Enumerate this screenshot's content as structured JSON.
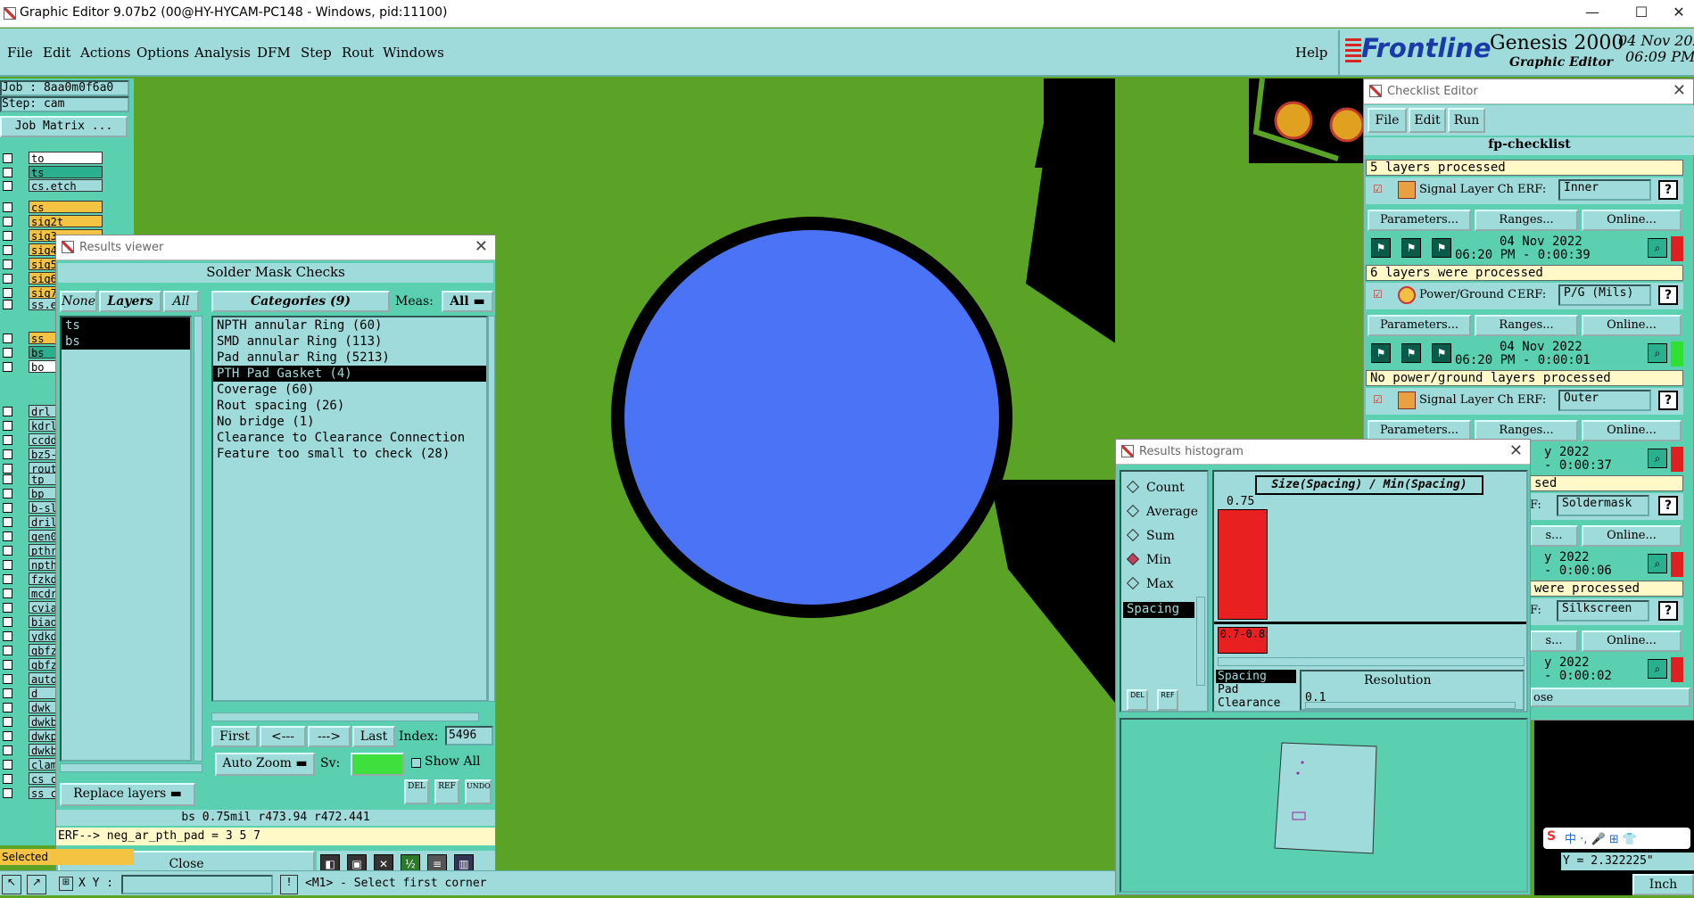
{
  "window": {
    "title": "Graphic Editor 9.07b2 (00@HY-HYCAM-PC148 - Windows, pid:11100)"
  },
  "menu": {
    "items": [
      "File",
      "Edit",
      "Actions",
      "Options",
      "Analysis",
      "DFM",
      "Step",
      "Rout",
      "Windows"
    ],
    "help": "Help"
  },
  "brand": {
    "logo": "Frontline",
    "product": "Genesis 2000",
    "subtitle": "Graphic Editor",
    "date": "04 Nov 202",
    "time": "06:09 PM"
  },
  "job": {
    "job_label": "Job : 8aa0m0f6a0",
    "step_label": "Step: cam",
    "matrix_button": "Job Matrix ..."
  },
  "layers": [
    {
      "name": "to",
      "color": "#ffffff"
    },
    {
      "name": "ts",
      "color": "#2bb08f"
    },
    {
      "name": "cs.etch",
      "color": "#9fdbdb"
    },
    {
      "name": "cs",
      "color": "#f5c342"
    },
    {
      "name": "sig2t",
      "color": "#f5c342"
    },
    {
      "name": "sig3",
      "color": "#f5c342"
    },
    {
      "name": "sig4",
      "color": "#f5c342"
    },
    {
      "name": "sig5",
      "color": "#f5c342"
    },
    {
      "name": "sig6",
      "color": "#f5c342"
    },
    {
      "name": "sig7",
      "color": "#f5c342"
    },
    {
      "name": "ss.e",
      "color": "#9fdbdb"
    },
    {
      "name": "ss",
      "color": "#f5c342"
    },
    {
      "name": "bs",
      "color": "#2bb08f"
    },
    {
      "name": "bo",
      "color": "#ffffff"
    },
    {
      "name": "drl",
      "color": "#9fdbdb"
    },
    {
      "name": "kdrl",
      "color": "#9fdbdb"
    },
    {
      "name": "ccdd",
      "color": "#9fdbdb"
    },
    {
      "name": "bz5-",
      "color": "#9fdbdb"
    },
    {
      "name": "rout",
      "color": "#9fdbdb"
    },
    {
      "name": "tp",
      "color": "#9fdbdb"
    },
    {
      "name": "bp",
      "color": "#9fdbdb"
    },
    {
      "name": "b-sl",
      "color": "#9fdbdb"
    },
    {
      "name": "dril",
      "color": "#9fdbdb"
    },
    {
      "name": "gen0",
      "color": "#9fdbdb"
    },
    {
      "name": "pthr",
      "color": "#9fdbdb"
    },
    {
      "name": "npth",
      "color": "#9fdbdb"
    },
    {
      "name": "fzkd",
      "color": "#9fdbdb"
    },
    {
      "name": "mcdr",
      "color": "#9fdbdb"
    },
    {
      "name": "cvia",
      "color": "#9fdbdb"
    },
    {
      "name": "biao",
      "color": "#9fdbdb"
    },
    {
      "name": "ydkd",
      "color": "#9fdbdb"
    },
    {
      "name": "gbfz",
      "color": "#9fdbdb"
    },
    {
      "name": "gbfz",
      "color": "#9fdbdb"
    },
    {
      "name": "auto",
      "color": "#9fdbdb"
    },
    {
      "name": "d",
      "color": "#9fdbdb"
    },
    {
      "name": "dwk",
      "color": "#9fdbdb"
    },
    {
      "name": "dwkb",
      "color": "#9fdbdb"
    },
    {
      "name": "dwkp",
      "color": "#9fdbdb"
    },
    {
      "name": "dwkb",
      "color": "#9fdbdb"
    },
    {
      "name": "clam",
      "color": "#9fdbdb"
    },
    {
      "name": "cs_c",
      "color": "#9fdbdb"
    },
    {
      "name": "ss_c",
      "color": "#9fdbdb"
    }
  ],
  "results_viewer": {
    "title": "Results viewer",
    "header": "Solder Mask Checks",
    "none_btn": "None",
    "layers_btn": "Layers",
    "all_btn": "All",
    "layer_list": [
      "ts",
      "bs"
    ],
    "categories_btn": "Categories (9)",
    "meas_label": "Meas:",
    "meas_value": "All",
    "categories": [
      "NPTH annular Ring (60)",
      "SMD annular Ring (113)",
      "Pad annular Ring (5213)",
      "PTH Pad Gasket (4)",
      "Coverage (60)",
      "Rout spacing (26)",
      "No bridge (1)",
      "Clearance to Clearance Connection",
      "Feature too small to check (28)"
    ],
    "first": "First",
    "prev": "<---",
    "next": "--->",
    "last": "Last",
    "index_label": "Index:",
    "index_value": "5496",
    "auto_zoom": "Auto Zoom",
    "sv_label": "Sv:",
    "show_all": "Show All",
    "replace_layers": "Replace layers",
    "del": "DEL",
    "ref": "REF",
    "undo": "UNDO",
    "info": "bs 0.75mil  r473.94  r472.441",
    "erf": "ERF--> neg_ar_pth_pad = 3 5 7",
    "close": "Close"
  },
  "checklist": {
    "title": "Checklist Editor",
    "menu": [
      "File",
      "Edit",
      "Run"
    ],
    "name": "fp-checklist",
    "status1": "5 layers processed",
    "item1": {
      "name": "Signal Layer Ch",
      "erf": "ERF:",
      "erf_value": "Inner",
      "date": "04 Nov 2022",
      "time": "06:20 PM - 0:00:39"
    },
    "status2": "6 layers were processed",
    "item2": {
      "name": "Power/Ground C",
      "erf": "ERF:",
      "erf_value": "P/G (Mils)",
      "date": "04 Nov 2022",
      "time": "06:20 PM - 0:00:01"
    },
    "status3": "No power/ground layers processed",
    "item3": {
      "name": "Signal Layer Ch",
      "erf": "ERF:",
      "erf_value": "Outer",
      "date": "y 2022",
      "time": "- 0:00:37"
    },
    "status4": "sed",
    "erf4": "Soldermask",
    "date5": "y 2022",
    "time5": "- 0:00:06",
    "status5": "were processed",
    "erf6": "Silkscreen",
    "date6": "y 2022",
    "time6": "- 0:00:02",
    "params": "Parameters...",
    "ranges": "Ranges...",
    "online": "Online...",
    "params_short": "s...",
    "erf_short": "F:",
    "close_short": "ose"
  },
  "histogram": {
    "title": "Results histogram",
    "options": [
      "Count",
      "Average",
      "Sum",
      "Min",
      "Max"
    ],
    "selected": "Min",
    "list": [
      "Spacing"
    ],
    "chart_title": "Size(Spacing) / Min(Spacing)",
    "bar_value": "0.75",
    "bin_label": "0.7-0.8",
    "meas_list": [
      "Spacing",
      "Pad",
      "Clearance"
    ],
    "resolution_label": "Resolution",
    "resolution_value": "0.1",
    "del": "DEL",
    "ref": "REF"
  },
  "bottom": {
    "xy_label": "X Y :",
    "prompt": "<M1> - Select first corner",
    "selected": "Selected",
    "y_readout": "Y = 2.322225\"",
    "units": "Inch"
  }
}
